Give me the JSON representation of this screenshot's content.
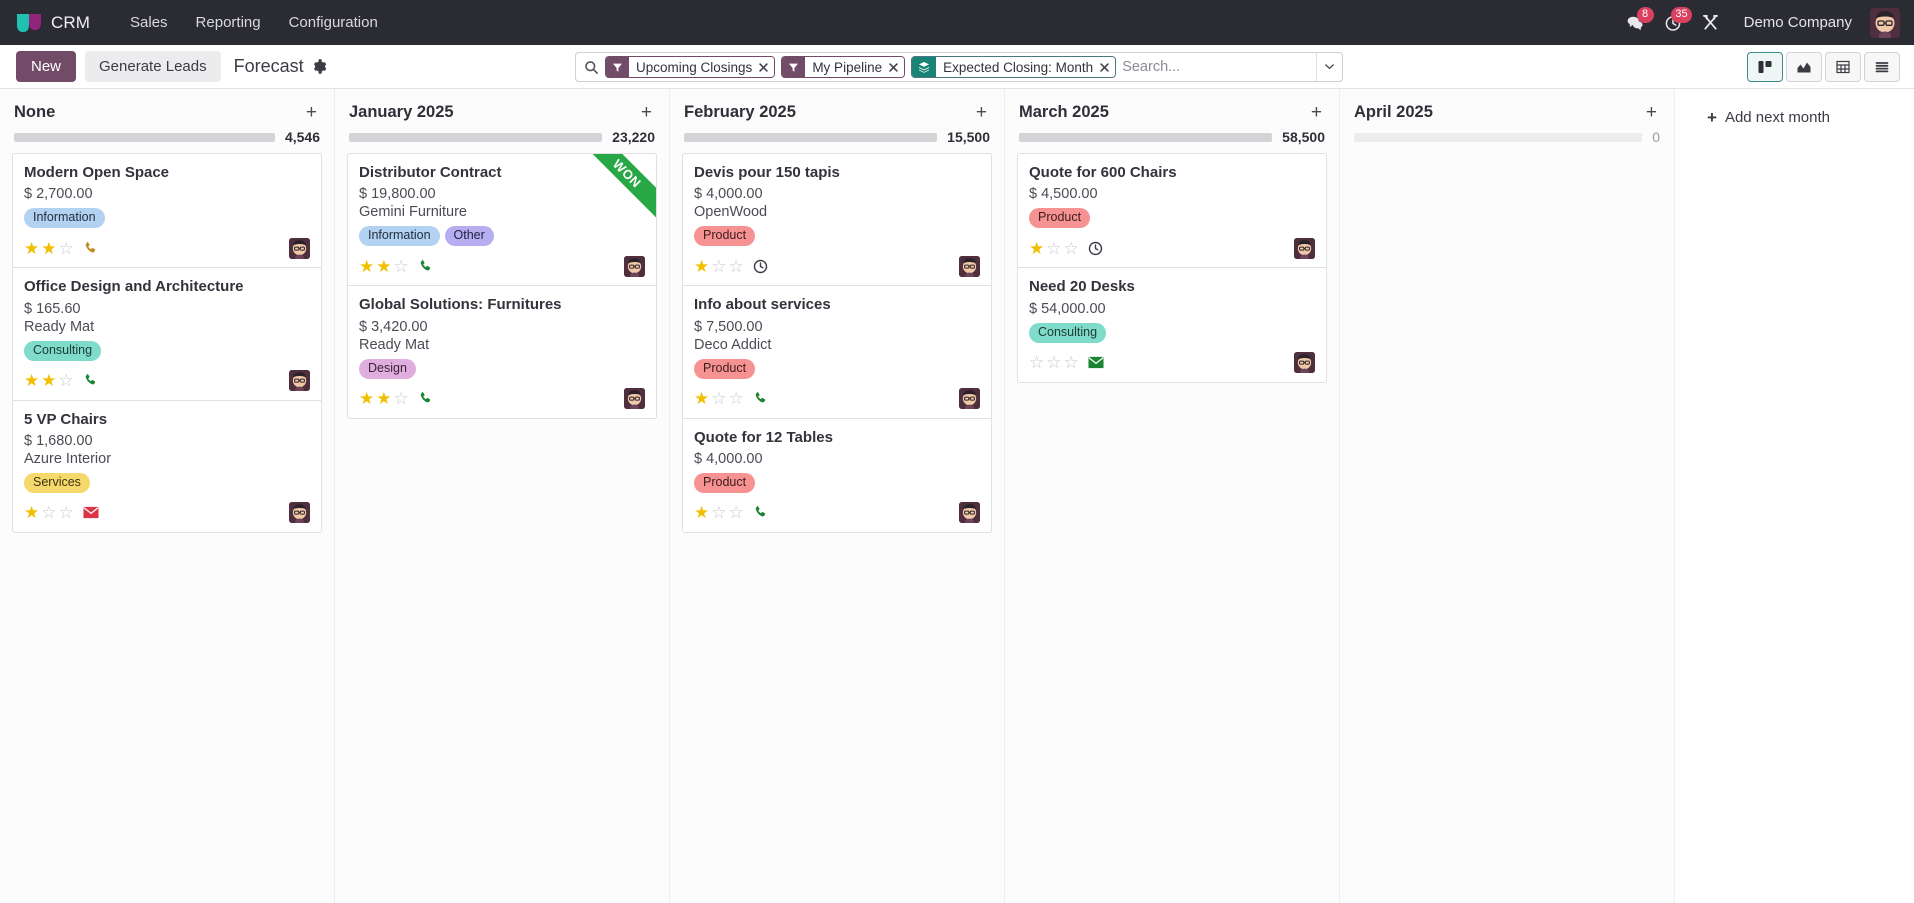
{
  "navbar": {
    "brand": "CRM",
    "menu": [
      "Sales",
      "Reporting",
      "Configuration"
    ],
    "messages_icon": "messages-icon",
    "messages_count": "8",
    "activities_icon": "activities-clock-icon",
    "activities_count": "35",
    "tools_icon": "tools-icon",
    "company": "Demo Company",
    "avatar": "user-avatar"
  },
  "control": {
    "new_label": "New",
    "generate_label": "Generate Leads",
    "breadcrumb": "Forecast",
    "gear_icon": "gear-icon"
  },
  "search": {
    "placeholder": "Search...",
    "value": "",
    "icon": "search-icon",
    "caret_icon": "chevron-down-icon",
    "facets": [
      {
        "label": "Upcoming Closings",
        "icon": "filter-icon",
        "kind": "filter"
      },
      {
        "label": "My Pipeline",
        "icon": "filter-icon",
        "kind": "filter"
      },
      {
        "label": "Expected Closing: Month",
        "icon": "layers-icon",
        "kind": "groupby"
      }
    ]
  },
  "views": [
    {
      "name": "kanban",
      "icon": "kanban-icon",
      "active": true
    },
    {
      "name": "graph",
      "icon": "graph-icon",
      "active": false
    },
    {
      "name": "pivot",
      "icon": "pivot-icon",
      "active": false
    },
    {
      "name": "list",
      "icon": "list-icon",
      "active": false
    }
  ],
  "add_next_month": "Add next month",
  "colors": {
    "brand_purple": "#714b67",
    "progress_green": "#28a745",
    "badge_red": "#d9415f",
    "groupby_teal": "#1a8277"
  },
  "columns": [
    {
      "title": "None",
      "total": "4,546",
      "progress_percent": 0,
      "faint_track": false,
      "cards": [
        {
          "title": "Modern Open Space",
          "amount": "$ 2,700.00",
          "partner": "",
          "tags": [
            {
              "label": "Information",
              "bg": "#b3d1f0",
              "fg": "#21303f"
            }
          ],
          "stars": 2,
          "activity_icon": "phone-icon",
          "activity_color": "#c28a18",
          "won": false
        },
        {
          "title": "Office Design and Architecture",
          "amount": "$ 165.60",
          "partner": "Ready Mat",
          "tags": [
            {
              "label": "Consulting",
              "bg": "#7fdbca",
              "fg": "#1d3a36"
            }
          ],
          "stars": 2,
          "activity_icon": "phone-icon",
          "activity_color": "#1a8431",
          "won": false
        },
        {
          "title": "5 VP Chairs",
          "amount": "$ 1,680.00",
          "partner": "Azure Interior",
          "tags": [
            {
              "label": "Services",
              "bg": "#f5d96a",
              "fg": "#3c3416"
            }
          ],
          "stars": 1,
          "activity_icon": "mail-icon",
          "activity_color": "#dc3545",
          "won": false
        }
      ]
    },
    {
      "title": "January 2025",
      "total": "23,220",
      "progress_percent": 100,
      "faint_track": false,
      "cards": [
        {
          "title": "Distributor Contract",
          "amount": "$ 19,800.00",
          "partner": "Gemini Furniture",
          "tags": [
            {
              "label": "Information",
              "bg": "#b3d1f0",
              "fg": "#21303f"
            },
            {
              "label": "Other",
              "bg": "#b6aef0",
              "fg": "#24203f"
            }
          ],
          "stars": 2,
          "activity_icon": "phone-icon",
          "activity_color": "#1a8431",
          "won": true,
          "won_label": "WON"
        },
        {
          "title": "Global Solutions: Furnitures",
          "amount": "$ 3,420.00",
          "partner": "Ready Mat",
          "tags": [
            {
              "label": "Design",
              "bg": "#e0aede",
              "fg": "#3b2139"
            }
          ],
          "stars": 2,
          "activity_icon": "phone-icon",
          "activity_color": "#1a8431",
          "won": false
        }
      ]
    },
    {
      "title": "February 2025",
      "total": "15,500",
      "progress_percent": 67,
      "faint_track": false,
      "cards": [
        {
          "title": "Devis pour 150 tapis",
          "amount": "$ 4,000.00",
          "partner": "OpenWood",
          "tags": [
            {
              "label": "Product",
              "bg": "#f69292",
              "fg": "#3d1d1d"
            }
          ],
          "stars": 1,
          "activity_icon": "clock-icon",
          "activity_color": "#3c3c46",
          "won": false
        },
        {
          "title": "Info about services",
          "amount": "$ 7,500.00",
          "partner": "Deco Addict",
          "tags": [
            {
              "label": "Product",
              "bg": "#f69292",
              "fg": "#3d1d1d"
            }
          ],
          "stars": 1,
          "activity_icon": "phone-icon",
          "activity_color": "#1a8431",
          "won": false
        },
        {
          "title": "Quote for 12 Tables",
          "amount": "$ 4,000.00",
          "partner": "",
          "tags": [
            {
              "label": "Product",
              "bg": "#f69292",
              "fg": "#3d1d1d"
            }
          ],
          "stars": 1,
          "activity_icon": "phone-icon",
          "activity_color": "#1a8431",
          "won": false
        }
      ]
    },
    {
      "title": "March 2025",
      "total": "58,500",
      "progress_percent": 50,
      "faint_track": false,
      "cards": [
        {
          "title": "Quote for 600 Chairs",
          "amount": "$ 4,500.00",
          "partner": "",
          "tags": [
            {
              "label": "Product",
              "bg": "#f69292",
              "fg": "#3d1d1d"
            }
          ],
          "stars": 1,
          "activity_icon": "clock-icon",
          "activity_color": "#3c3c46",
          "won": false
        },
        {
          "title": "Need 20 Desks",
          "amount": "$ 54,000.00",
          "partner": "",
          "tags": [
            {
              "label": "Consulting",
              "bg": "#7fdbca",
              "fg": "#1d3a36"
            }
          ],
          "stars": 0,
          "activity_icon": "mail-icon",
          "activity_color": "#1a8431",
          "won": false
        }
      ]
    },
    {
      "title": "April 2025",
      "total": "0",
      "progress_percent": 0,
      "faint_track": true,
      "cards": []
    }
  ]
}
